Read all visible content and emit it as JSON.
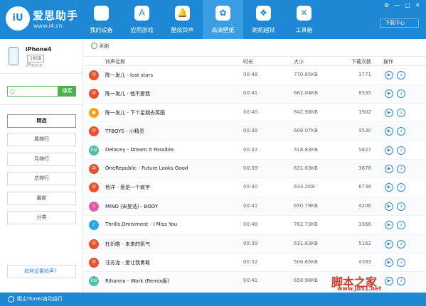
{
  "app": {
    "brand": "爱思助手",
    "url": "www.i4.cn",
    "logo_text": "iU",
    "download_center": "下载中心",
    "win_controls": [
      "⚙",
      "—",
      "□",
      "✕"
    ]
  },
  "nav": [
    {
      "label": "我的设备",
      "icon": "apple-icon",
      "glyph": ""
    },
    {
      "label": "应用游戏",
      "icon": "appstore-icon",
      "glyph": "A"
    },
    {
      "label": "酷炫铃声",
      "icon": "bell-icon",
      "glyph": "🔔"
    },
    {
      "label": "高清壁纸",
      "icon": "flower-icon",
      "glyph": "✿"
    },
    {
      "label": "刷机越狱",
      "icon": "dropbox-icon",
      "glyph": "❖"
    },
    {
      "label": "工具箱",
      "icon": "tools-icon",
      "glyph": "✕"
    }
  ],
  "device": {
    "name": "iPhone4",
    "capacity": "16GB",
    "type": "iPhone"
  },
  "search": {
    "placeholder": "",
    "button": "搜索"
  },
  "categories": [
    "精选",
    "周排行",
    "月排行",
    "总排行",
    "最新",
    "分类"
  ],
  "help_link": "如何设置铃声？",
  "status": "阻止iTunes自动运行",
  "toolbar": {
    "refresh": "刷新"
  },
  "table": {
    "headers": {
      "name": "铃声名称",
      "duration": "时长",
      "size": "大小",
      "downloads": "下载次数",
      "actions": "操作"
    },
    "rows": [
      {
        "badge": "中",
        "badge_color": "#e8502e",
        "title": "陈一发儿 - lost stars",
        "duration": "00:48",
        "size": "770.65KB",
        "downloads": "3771"
      },
      {
        "badge": "中",
        "badge_color": "#e8502e",
        "title": "陈一发儿 - 他不爱我",
        "duration": "00:41",
        "size": "662.04KB",
        "downloads": "8535"
      },
      {
        "badge": "▣",
        "badge_color": "#f0a020",
        "title": "陈一发儿 - 下个星期去英国",
        "duration": "00:40",
        "size": "642.98KB",
        "downloads": "1902"
      },
      {
        "badge": "中",
        "badge_color": "#e8502e",
        "title": "TFBOYS - 小精灵",
        "duration": "00:38",
        "size": "608.07KB",
        "downloads": "3530"
      },
      {
        "badge": "EN",
        "badge_color": "#4dbfa6",
        "title": "Delacey - Dream It Possible",
        "duration": "00:32",
        "size": "518.83KB",
        "downloads": "5827"
      },
      {
        "badge": "中",
        "badge_color": "#e8502e",
        "title": "OneRepublic - Future Looks Good",
        "duration": "00:39",
        "size": "631.63KB",
        "downloads": "3678"
      },
      {
        "badge": "中",
        "badge_color": "#e8502e",
        "title": "杨洋 - 爱是一个疯字",
        "duration": "00:40",
        "size": "633.2KB",
        "downloads": "6738"
      },
      {
        "badge": "♪",
        "badge_color": "#e05aa6",
        "title": "MINO (宋旻浩) - BODY",
        "duration": "00:41",
        "size": "650.79KB",
        "downloads": "4206"
      },
      {
        "badge": "♪",
        "badge_color": "#2aa6e8",
        "title": "Thrills,Omniment - I Miss You",
        "duration": "00:48",
        "size": "762.73KB",
        "downloads": "3366"
      },
      {
        "badge": "中",
        "badge_color": "#e8502e",
        "title": "杜炘皓 - 未来的氧气",
        "duration": "00:39",
        "size": "631.63KB",
        "downloads": "5162"
      },
      {
        "badge": "中",
        "badge_color": "#e8502e",
        "title": "汪苏泷 - 爱让我勇敢",
        "duration": "00:32",
        "size": "506.65KB",
        "downloads": "4383"
      },
      {
        "badge": "EN",
        "badge_color": "#4dbfa6",
        "title": "Rihanna - Work (Remix版)",
        "duration": "00:41",
        "size": "650.98KB",
        "downloads": "2"
      }
    ]
  },
  "watermark": {
    "text": "脚本之家",
    "url": "www.jb51.net"
  }
}
